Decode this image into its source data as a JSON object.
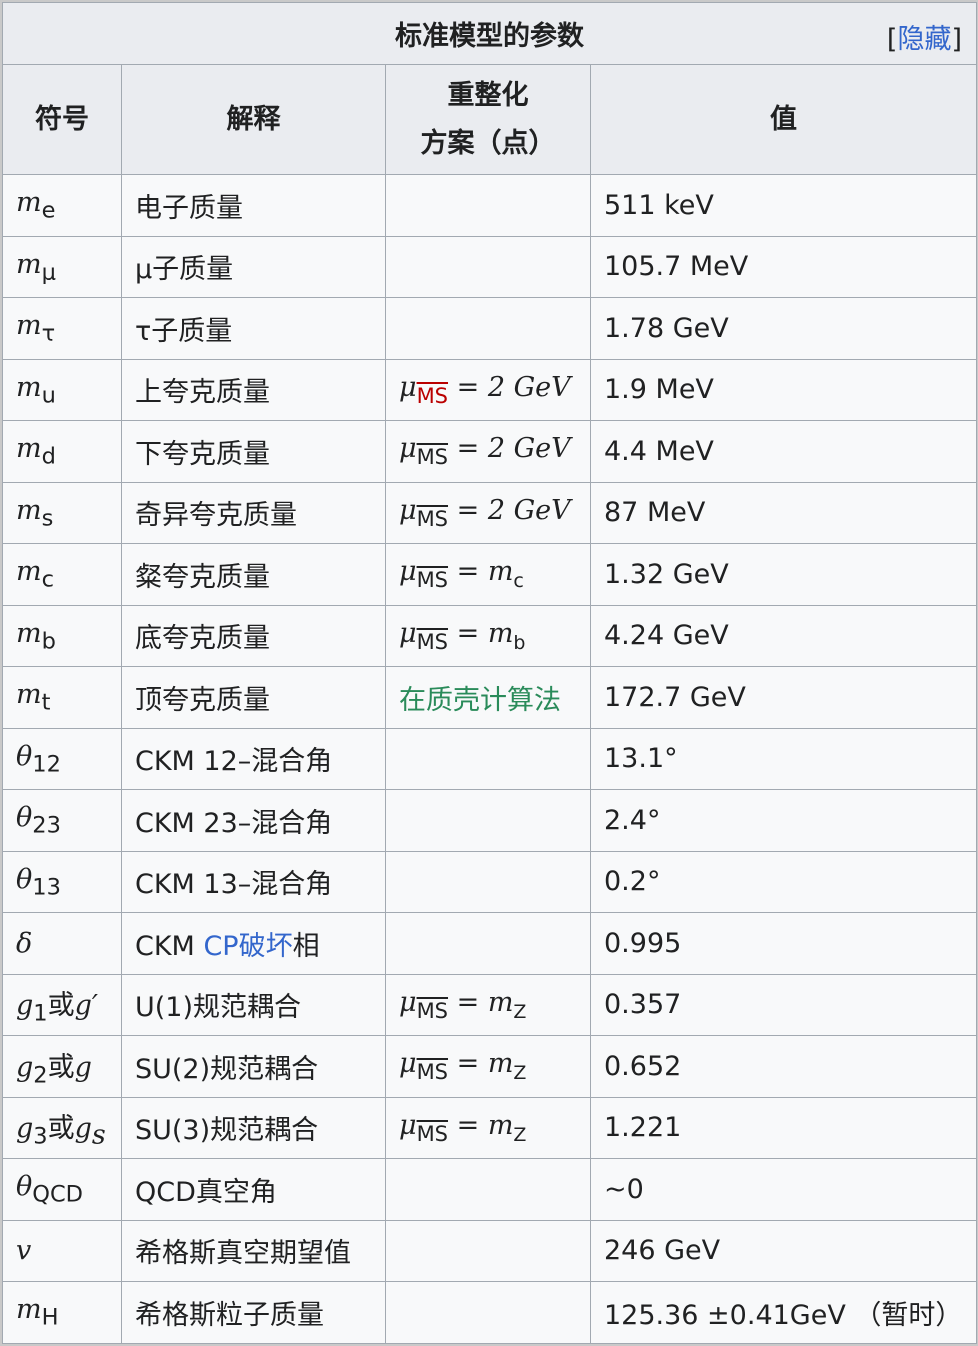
{
  "caption": "标准模型的参数",
  "hide_label": "隐藏",
  "headers": {
    "symbol": "符号",
    "explanation": "解释",
    "scheme_line1": "重整化",
    "scheme_line2": "方案（点）",
    "value": "值"
  },
  "rows": [
    {
      "sym": "m",
      "sub": "e",
      "desc": "电子质量",
      "scheme": "",
      "value": "511 keV"
    },
    {
      "sym": "m",
      "sub": "μ",
      "desc": "μ子质量",
      "scheme": "",
      "value": "105.7 MeV"
    },
    {
      "sym": "m",
      "sub": "τ",
      "desc": "τ子质量",
      "scheme": "",
      "value": "1.78 GeV"
    },
    {
      "sym": "m",
      "sub": "u",
      "desc": "上夸克质量",
      "scheme_mu": "μ",
      "scheme_ms": "MS",
      "scheme_rhs": "= 2 GeV",
      "value": "1.9 MeV"
    },
    {
      "sym": "m",
      "sub": "d",
      "desc": "下夸克质量",
      "scheme_mu": "μ",
      "scheme_ms": "MS",
      "scheme_rhs": "= 2 GeV",
      "value": "4.4 MeV"
    },
    {
      "sym": "m",
      "sub": "s",
      "desc": "奇异夸克质量",
      "scheme_mu": "μ",
      "scheme_ms": "MS",
      "scheme_rhs": "= 2 GeV",
      "value": "87 MeV"
    },
    {
      "sym": "m",
      "sub": "c",
      "desc": "粲夸克质量",
      "scheme_mu": "μ",
      "scheme_ms": "MS",
      "scheme_rhs": "= m",
      "scheme_rhs_sub": "c",
      "value": "1.32 GeV"
    },
    {
      "sym": "m",
      "sub": "b",
      "desc": "底夸克质量",
      "scheme_mu": "μ",
      "scheme_ms": "MS",
      "scheme_rhs": "= m",
      "scheme_rhs_sub": "b",
      "value": "4.24 GeV"
    },
    {
      "sym": "m",
      "sub": "t",
      "desc": "顶夸克质量",
      "scheme_link": "在质壳计算法",
      "value": "172.7 GeV"
    },
    {
      "sym": "θ",
      "sub": "12",
      "desc": "CKM 12–混合角",
      "scheme": "",
      "value": "13.1°"
    },
    {
      "sym": "θ",
      "sub": "23",
      "desc": "CKM 23–混合角",
      "scheme": "",
      "value": "2.4°"
    },
    {
      "sym": "θ",
      "sub": "13",
      "desc": "CKM 13–混合角",
      "scheme": "",
      "value": "0.2°"
    },
    {
      "sym": "δ",
      "sub": "",
      "desc_prefix": "CKM ",
      "desc_link": "CP破坏",
      "desc_suffix": "相",
      "scheme": "",
      "value": "0.995"
    },
    {
      "sym": "g",
      "sub": "1",
      "sym_or": "或",
      "sym2": "g′",
      "sym2_sub": "",
      "desc": "U(1)规范耦合",
      "scheme_mu": "μ",
      "scheme_ms": "MS",
      "scheme_rhs": "= m",
      "scheme_rhs_sub": "Z",
      "value": "0.357"
    },
    {
      "sym": "g",
      "sub": "2",
      "sym_or": "或",
      "sym2": "g",
      "sym2_sub": "",
      "desc": "SU(2)规范耦合",
      "scheme_mu": "μ",
      "scheme_ms": "MS",
      "scheme_rhs": "= m",
      "scheme_rhs_sub": "Z",
      "value": "0.652"
    },
    {
      "sym": "g",
      "sub": "3",
      "sym_or": "或",
      "sym2": "g",
      "sym2_sub": "s",
      "desc": "SU(3)规范耦合",
      "scheme_mu": "μ",
      "scheme_ms": "MS",
      "scheme_rhs": "= m",
      "scheme_rhs_sub": "Z",
      "value": "1.221"
    },
    {
      "sym": "θ",
      "sub": "QCD",
      "desc": "QCD真空角",
      "scheme": "",
      "value": "~0"
    },
    {
      "sym": "v",
      "sub": "",
      "desc": "希格斯真空期望值",
      "scheme": "",
      "value": "246 GeV"
    },
    {
      "sym": "m",
      "sub": "H",
      "desc": "希格斯粒子质量",
      "scheme": "",
      "value": "125.36 ±0.41GeV （暂时）"
    }
  ],
  "colors": {
    "link": "#3366cc",
    "red_link": "#ba0000",
    "green_link": "#2a8b5a",
    "header_bg": "#eaecf0",
    "border": "#a2a9b1"
  }
}
